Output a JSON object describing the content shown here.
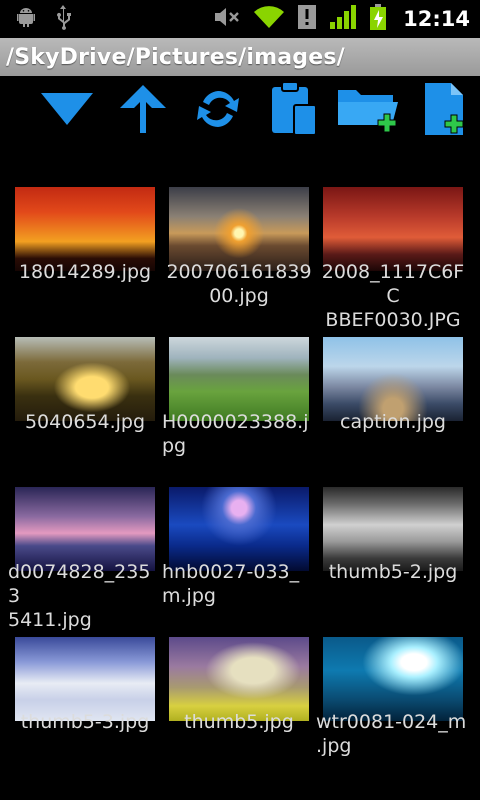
{
  "status_bar": {
    "time": "12:14",
    "icons": [
      "android-icon",
      "usb-icon",
      "mute-icon",
      "wifi-icon",
      "alert-icon",
      "signal-icon",
      "battery-charging-icon"
    ]
  },
  "path_bar": {
    "path": "/SkyDrive/Pictures/images/"
  },
  "toolbar": {
    "buttons": [
      {
        "icon": "download-arrow-icon"
      },
      {
        "icon": "up-arrow-icon"
      },
      {
        "icon": "refresh-icon"
      },
      {
        "icon": "paste-icon"
      },
      {
        "icon": "new-folder-icon"
      },
      {
        "icon": "new-file-icon"
      }
    ]
  },
  "files": [
    {
      "name": "18014289.jpg",
      "caption_lines": [
        "18014289.jpg"
      ]
    },
    {
      "name": "20070616183900.jpg",
      "caption_lines": [
        "200706161839",
        "00.jpg"
      ]
    },
    {
      "name": "2008_1117C6FCBBEF0030.JPG",
      "caption_lines": [
        "2008_1117C6FC",
        "BBEF0030.JPG"
      ]
    },
    {
      "name": "5040654.jpg",
      "caption_lines": [
        "5040654.jpg"
      ]
    },
    {
      "name": "H0000023388.jpg",
      "caption_lines": [
        "H0000023388.j",
        "pg"
      ]
    },
    {
      "name": "caption.jpg",
      "caption_lines": [
        "caption.jpg"
      ]
    },
    {
      "name": "d0074828_23535411.jpg",
      "caption_lines": [
        "d0074828_2353",
        "5411.jpg"
      ]
    },
    {
      "name": "hnb0027-033_m.jpg",
      "caption_lines": [
        "hnb0027-033_",
        "m.jpg"
      ]
    },
    {
      "name": "thumb5-2.jpg",
      "caption_lines": [
        "thumb5-2.jpg"
      ]
    },
    {
      "name": "thumb5-3.jpg",
      "caption_lines": [
        "thumb5-3.jpg"
      ]
    },
    {
      "name": "thumb5.jpg",
      "caption_lines": [
        "thumb5.jpg"
      ]
    },
    {
      "name": "wtr0081-024_m.jpg",
      "caption_lines": [
        "wtr0081-024_m",
        ".jpg"
      ]
    }
  ],
  "colors": {
    "accent": "#1e90e8",
    "path_bar_bg": "#a8a8a8",
    "status_green": "#8ad400"
  }
}
